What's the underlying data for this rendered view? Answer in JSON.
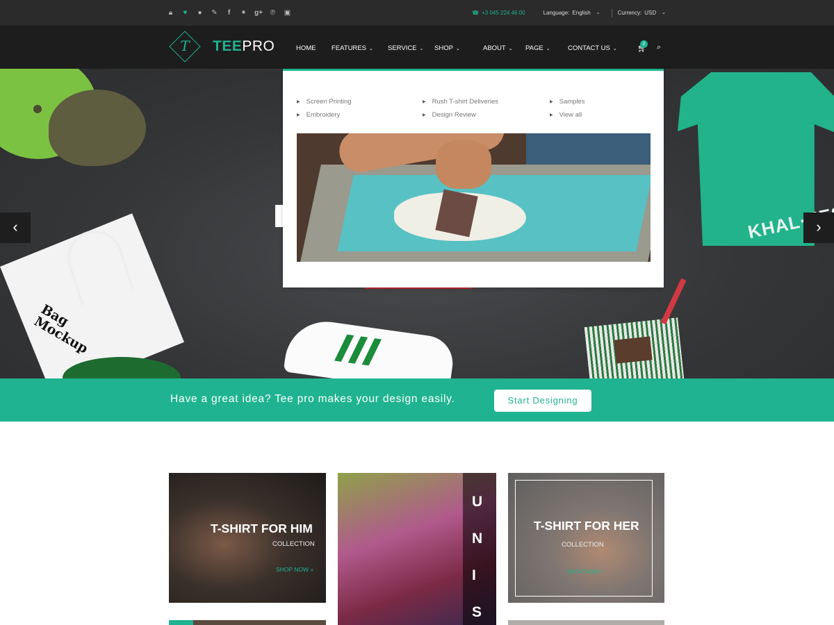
{
  "topbar": {
    "social_icons": [
      "lock-icon",
      "heart-icon",
      "user-icon",
      "pencil-icon",
      "facebook-icon",
      "twitter-icon",
      "google-plus-icon",
      "pinterest-icon",
      "instagram-icon"
    ],
    "phone": "+3 045 224 46 00",
    "language_label": "Language:",
    "language_value": "English",
    "currency_label": "Currency:",
    "currency_value": "USD"
  },
  "header": {
    "logo_glyph": "T",
    "logo_text_bold": "TEE",
    "logo_text_light": "PRO",
    "nav": [
      {
        "label": "HOME",
        "caret": ""
      },
      {
        "label": "FEATURES",
        "caret": "⌄"
      },
      {
        "label": "SERVICE",
        "caret": "⌄"
      },
      {
        "label": "SHOP",
        "caret": "⌄"
      },
      {
        "label": "ABOUT",
        "caret": "⌄"
      },
      {
        "label": "PAGE",
        "caret": "⌄"
      },
      {
        "label": "CONTACT US",
        "caret": "⌄"
      }
    ],
    "cart_count": "2"
  },
  "dropdown": {
    "columns": [
      [
        "Screen Printing",
        "Embroidery"
      ],
      [
        "Rush T-shirt Deliveries",
        "Design Review"
      ],
      [
        "Samples",
        "View all"
      ]
    ]
  },
  "hero": {
    "tee_print": "KHAL·EESI",
    "bag_text": "Bag\nMockup"
  },
  "cta": {
    "text": "Have a great idea? Tee pro makes your design easily.",
    "button": "Start Designing"
  },
  "collections": {
    "him": {
      "title": "T-SHIRT FOR HIM",
      "sub": "COLLECTION",
      "shop": "SHOP NOW »"
    },
    "unisex": {
      "letters": [
        "U",
        "N",
        "I",
        "S"
      ]
    },
    "her": {
      "title": "T-SHIRT FOR HER",
      "sub": "COLLECTION",
      "shop": "SHOP NOW »"
    }
  },
  "colors": {
    "accent": "#1fb391",
    "topbar_bg": "#2b2b2b",
    "header_bg": "#1d1d1d"
  }
}
